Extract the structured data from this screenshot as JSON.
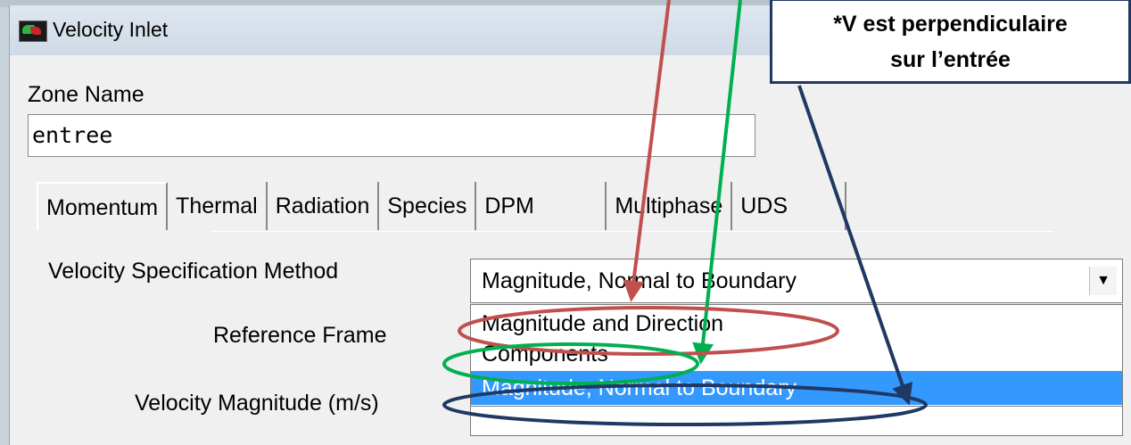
{
  "window": {
    "title": "Velocity Inlet"
  },
  "zone": {
    "label": "Zone Name",
    "value": "entree"
  },
  "tabs": [
    {
      "label": "Momentum"
    },
    {
      "label": "Thermal"
    },
    {
      "label": "Radiation"
    },
    {
      "label": "Species"
    },
    {
      "label": "DPM"
    },
    {
      "label": "Multiphase"
    },
    {
      "label": "UDS"
    }
  ],
  "velocity_spec": {
    "label": "Velocity Specification Method",
    "selected": "Magnitude, Normal to Boundary",
    "arrow": "▼",
    "options": [
      "Magnitude and Direction",
      "Components",
      "Magnitude, Normal to Boundary"
    ]
  },
  "reference_frame": {
    "label": "Reference Frame"
  },
  "velocity_magnitude": {
    "label": "Velocity Magnitude (m/s)"
  },
  "annotation": {
    "line1": "*V est perpendiculaire",
    "line2": "sur l’entrée"
  },
  "colors": {
    "red": "#c0504d",
    "green": "#00b050",
    "navy": "#1f3864",
    "highlight": "#3399ff"
  },
  "icons": {
    "app": "fluent-app-icon",
    "dropdown": "chevron-down-icon"
  }
}
